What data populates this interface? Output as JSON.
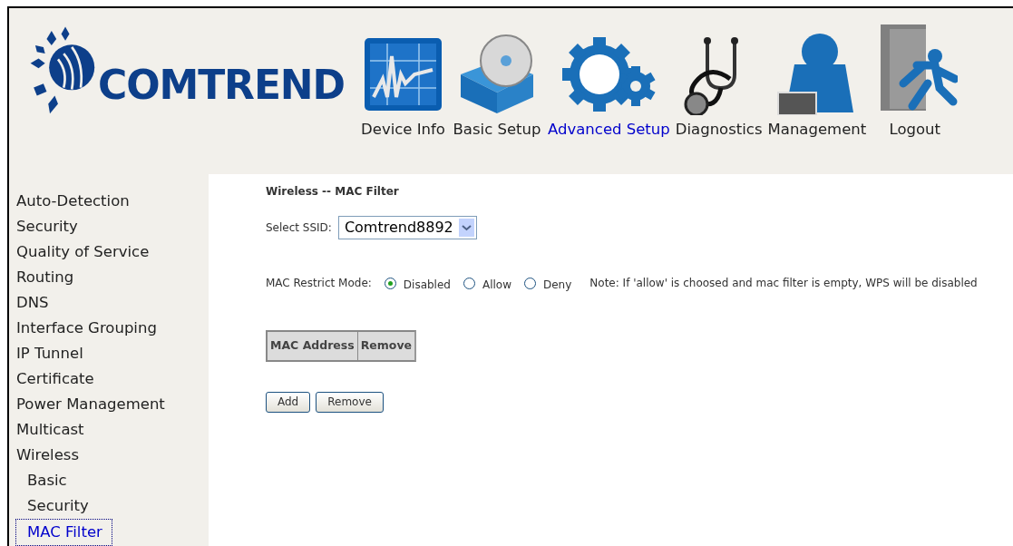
{
  "logo_text": "COMTREND",
  "nav": [
    {
      "label": "Device Info",
      "selected": false
    },
    {
      "label": "Basic Setup",
      "selected": false
    },
    {
      "label": "Advanced Setup",
      "selected": true
    },
    {
      "label": "Diagnostics",
      "selected": false
    },
    {
      "label": "Management",
      "selected": false
    },
    {
      "label": "Logout",
      "selected": false
    }
  ],
  "sidebar": [
    {
      "label": "Auto-Detection",
      "selected": false
    },
    {
      "label": "Security",
      "selected": false
    },
    {
      "label": "Quality of Service",
      "selected": false
    },
    {
      "label": "Routing",
      "selected": false
    },
    {
      "label": "DNS",
      "selected": false
    },
    {
      "label": "Interface Grouping",
      "selected": false
    },
    {
      "label": "IP Tunnel",
      "selected": false
    },
    {
      "label": "Certificate",
      "selected": false
    },
    {
      "label": "Power Management",
      "selected": false
    },
    {
      "label": "Multicast",
      "selected": false
    },
    {
      "label": "Wireless",
      "selected": false,
      "children": [
        {
          "label": "Basic",
          "selected": false
        },
        {
          "label": "Security",
          "selected": false
        },
        {
          "label": "MAC Filter",
          "selected": true
        }
      ]
    }
  ],
  "page_title": "Wireless -- MAC Filter",
  "ssid": {
    "label": "Select SSID:",
    "value": "Comtrend8892"
  },
  "restrict_mode": {
    "label": "MAC Restrict Mode:",
    "options": [
      {
        "label": "Disabled",
        "selected": true
      },
      {
        "label": "Allow",
        "selected": false
      },
      {
        "label": "Deny",
        "selected": false
      }
    ],
    "note": "Note: If 'allow' is choosed and mac filter is empty, WPS will be disabled"
  },
  "table": {
    "columns": [
      "MAC Address",
      "Remove"
    ]
  },
  "buttons": [
    "Add",
    "Remove"
  ]
}
